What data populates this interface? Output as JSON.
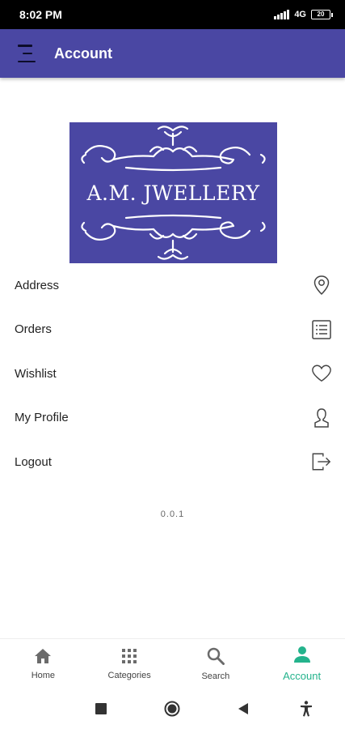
{
  "status_bar": {
    "time": "8:02 PM",
    "network": "4G",
    "battery": "20"
  },
  "app_bar": {
    "title": "Account",
    "color": "#4a47a3"
  },
  "logo": {
    "text": "A.M. JWELLERY"
  },
  "menu": {
    "items": [
      {
        "label": "Address",
        "icon": "location-pin-icon"
      },
      {
        "label": "Orders",
        "icon": "list-icon"
      },
      {
        "label": "Wishlist",
        "icon": "heart-icon"
      },
      {
        "label": "My Profile",
        "icon": "user-icon"
      },
      {
        "label": "Logout",
        "icon": "logout-icon"
      }
    ]
  },
  "version": "0.0.1",
  "bottom_nav": {
    "items": [
      {
        "label": "Home",
        "icon": "home-icon"
      },
      {
        "label": "Categories",
        "icon": "grid-icon"
      },
      {
        "label": "Search",
        "icon": "search-icon"
      },
      {
        "label": "Account",
        "icon": "account-icon"
      }
    ],
    "active_color": "#24b38c"
  },
  "system_nav": [
    "square-icon",
    "circle-home-icon",
    "back-triangle-icon",
    "accessibility-icon"
  ]
}
